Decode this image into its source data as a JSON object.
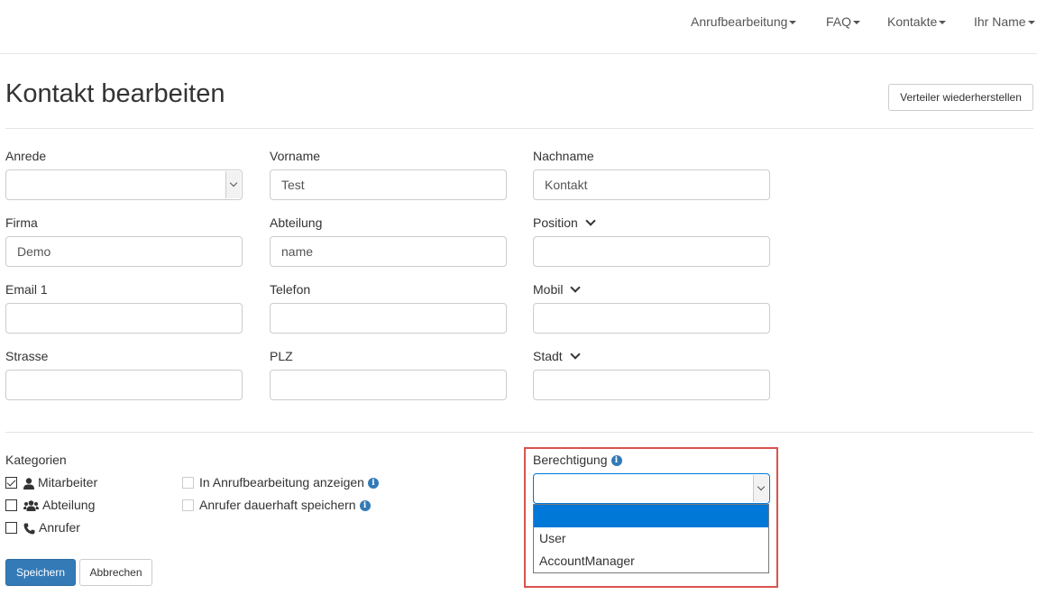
{
  "nav": {
    "items": [
      {
        "label": "Anrufbearbeitung"
      },
      {
        "label": "FAQ"
      },
      {
        "label": "Kontakte"
      },
      {
        "label": "Ihr Name"
      }
    ]
  },
  "header": {
    "title": "Kontakt bearbeiten",
    "restore_button": "Verteiler wiederherstellen"
  },
  "form": {
    "anrede": {
      "label": "Anrede",
      "value": ""
    },
    "vorname": {
      "label": "Vorname",
      "value": "Test"
    },
    "nachname": {
      "label": "Nachname",
      "value": "Kontakt"
    },
    "firma": {
      "label": "Firma",
      "value": "Demo"
    },
    "abteilung": {
      "label": "Abteilung",
      "value": "name"
    },
    "position": {
      "label": "Position",
      "value": ""
    },
    "email1": {
      "label": "Email 1",
      "value": ""
    },
    "telefon": {
      "label": "Telefon",
      "value": ""
    },
    "mobil": {
      "label": "Mobil",
      "value": ""
    },
    "strasse": {
      "label": "Strasse",
      "value": ""
    },
    "plz": {
      "label": "PLZ",
      "value": ""
    },
    "stadt": {
      "label": "Stadt",
      "value": ""
    }
  },
  "kategorien": {
    "label": "Kategorien",
    "items": [
      {
        "label": "Mitarbeiter",
        "checked": true,
        "icon": "user-icon"
      },
      {
        "label": "Abteilung",
        "checked": false,
        "icon": "users-icon"
      },
      {
        "label": "Anrufer",
        "checked": false,
        "icon": "phone-icon"
      }
    ],
    "options": [
      {
        "label": "In Anrufbearbeitung anzeigen",
        "checked": false
      },
      {
        "label": "Anrufer dauerhaft speichern",
        "checked": false
      }
    ]
  },
  "berechtigung": {
    "label": "Berechtigung",
    "value": "",
    "options": [
      "",
      "User",
      "AccountManager"
    ]
  },
  "actions": {
    "save": "Speichern",
    "cancel": "Abbrechen"
  },
  "colors": {
    "primary": "#337ab7",
    "highlight_border": "#d9534f",
    "dropdown_selected": "#0078d7"
  }
}
